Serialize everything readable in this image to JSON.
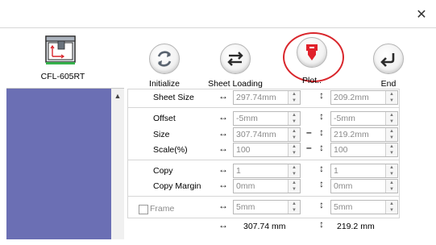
{
  "window": {
    "close_glyph": "✕"
  },
  "device": {
    "model": "CFL-605RT",
    "icon": "cutting-plotter-icon"
  },
  "toolbar": {
    "initialize_label": "Initialize",
    "sheet_loading_label": "Sheet Loading",
    "plot_label": "Plot..",
    "end_label": "End",
    "plot_highlight_color": "#d9262c"
  },
  "form": {
    "sheet_size": {
      "label": "Sheet Size",
      "width": "297.74mm",
      "height": "209.2mm"
    },
    "offset": {
      "label": "Offset",
      "x": "-5mm",
      "y": "-5mm"
    },
    "size": {
      "label": "Size",
      "width": "307.74mm",
      "height": "219.2mm"
    },
    "scale": {
      "label": "Scale(%)",
      "x": "100",
      "y": "100"
    },
    "copy": {
      "label": "Copy",
      "x": "1",
      "y": "1"
    },
    "copy_margin": {
      "label": "Copy Margin",
      "x": "0mm",
      "y": "0mm"
    },
    "frame": {
      "label": "Frame",
      "checked": false,
      "x": "5mm",
      "y": "5mm"
    },
    "result": {
      "width": "307.74 mm",
      "height": "219.2 mm"
    }
  },
  "colors": {
    "list_bg": "#6b6fb4",
    "plot_icon": "#e0202a"
  }
}
